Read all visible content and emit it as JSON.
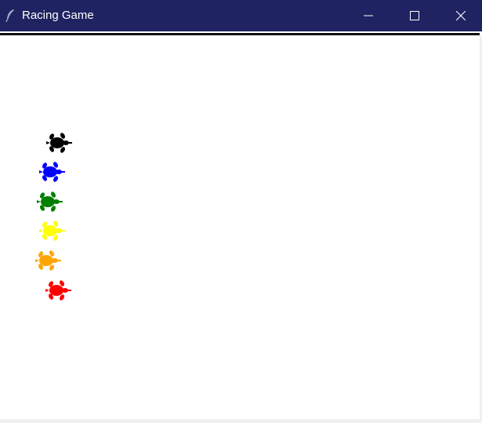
{
  "window": {
    "title": "Racing Game",
    "icon": "feather-icon",
    "controls": [
      "minimize-icon",
      "maximize-icon",
      "close-icon"
    ]
  },
  "colors": {
    "titlebar": "#1f2361",
    "canvas": "#ffffff"
  },
  "turtles": [
    {
      "color": "black"
    },
    {
      "color": "blue"
    },
    {
      "color": "green"
    },
    {
      "color": "yellow"
    },
    {
      "color": "orange"
    },
    {
      "color": "red"
    }
  ]
}
